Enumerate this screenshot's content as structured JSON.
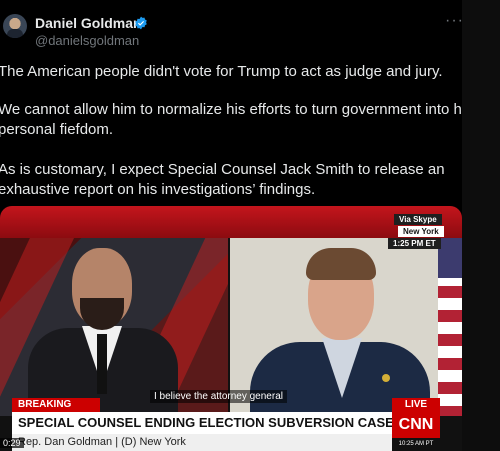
{
  "author": {
    "name": "Daniel Goldman",
    "handle": "@danielsgoldman",
    "verified_icon": "verified-badge-icon",
    "accent_color": "#1d9bf0"
  },
  "menu_icon": "···",
  "tweet": {
    "p1": "The American people didn't vote for Trump to act as judge and jury.",
    "p2a": "We cannot allow him to normalize his efforts to turn government into his",
    "p2b": "personal fiefdom.",
    "p3a": "As is customary, I expect Special Counsel Jack Smith to release an",
    "p3b": "exhaustive report on his investigations’ findings."
  },
  "video": {
    "tag_via": "Via Skype",
    "tag_city": "New York",
    "tag_time": "1:25 PM ET",
    "caption": "I believe the attorney general",
    "breaking": "BREAKING NEWS",
    "live": "LIVE",
    "headline": "SPECIAL COUNSEL ENDING ELECTION SUBVERSION CASE AGAINST TRUMP",
    "subline": "Rep. Dan Goldman  |  (D) New York",
    "network": "CNN",
    "network_time": "10:25 AM PT",
    "timecode": "0:29"
  }
}
